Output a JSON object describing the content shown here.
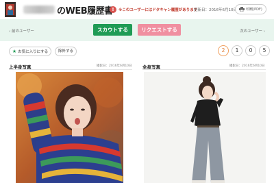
{
  "header": {
    "title": "のWEB履歴書",
    "warning_icon": "!",
    "warning": "※このユーザーにはドタキャン履歴があります",
    "updated": "更新日：2016年6月10日",
    "print_label": "印刷(PDF)"
  },
  "nav": {
    "prev": "前のユーザー",
    "next": "次のユーザー"
  },
  "actions": {
    "scout": "スカウトする",
    "request": "リクエストする"
  },
  "filters": {
    "favorite": "お気に入りにする",
    "exclude": "除外する"
  },
  "pager": {
    "pages": [
      "2",
      "1",
      "0",
      "5"
    ],
    "active_index": 0
  },
  "photos": [
    {
      "title": "上半身写真",
      "date": "撮影日：2016年6月10日"
    },
    {
      "title": "全身写真",
      "date": "撮影日：2016年6月10日"
    }
  ],
  "colors": {
    "scout": "#1f9b55",
    "request": "#f08fa0",
    "band": "#e8f5ee",
    "warning": "#c0392b",
    "pager_active": "#e07a30"
  }
}
